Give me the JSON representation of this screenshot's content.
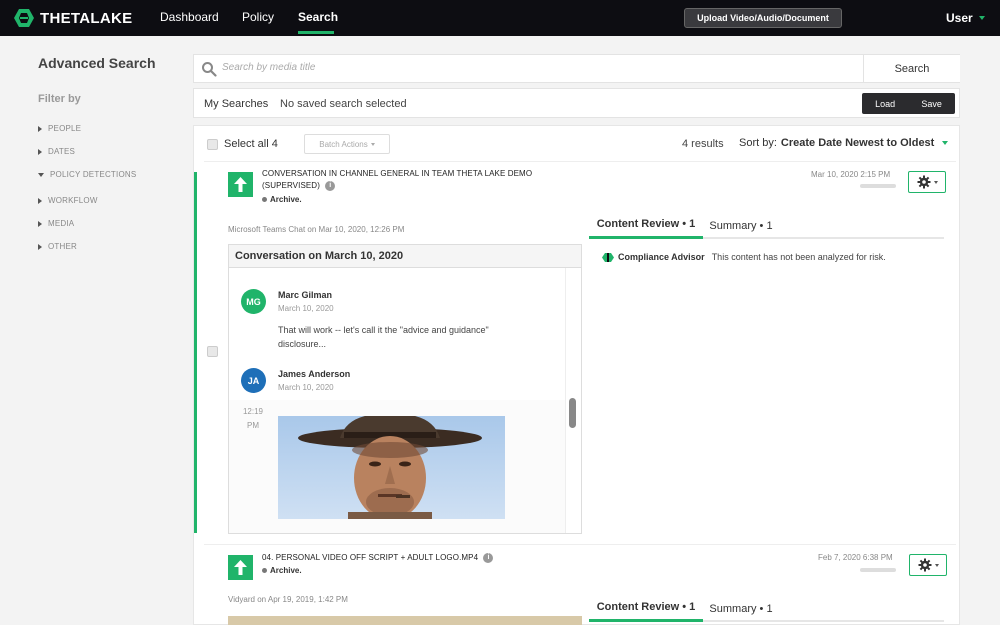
{
  "app": {
    "brand": "THETALAKE",
    "nav": [
      {
        "label": "Dashboard",
        "active": false
      },
      {
        "label": "Policy",
        "active": false
      },
      {
        "label": "Search",
        "active": true
      }
    ],
    "upload_label": "Upload Video/Audio/Document",
    "user_label": "User",
    "accent_color": "#20b46a"
  },
  "sidebar": {
    "title": "Advanced Search",
    "filter_label": "Filter by",
    "filters": [
      {
        "label": "PEOPLE",
        "expanded": false
      },
      {
        "label": "DATES",
        "expanded": false
      },
      {
        "label": "POLICY DETECTIONS",
        "expanded": true
      },
      {
        "label": "WORKFLOW",
        "expanded": false
      },
      {
        "label": "MEDIA",
        "expanded": false
      },
      {
        "label": "OTHER",
        "expanded": false
      }
    ]
  },
  "search": {
    "placeholder": "Search by media title",
    "button_label": "Search",
    "my_searches_label": "My Searches",
    "my_searches_value": "No saved search selected",
    "load_label": "Load",
    "save_label": "Save"
  },
  "results": {
    "select_all_label": "Select all 4",
    "batch_actions_label": "Batch Actions",
    "count_label": "4 results",
    "sort_label": "Sort by:",
    "sort_value": "Create Date Newest to Oldest",
    "items": [
      {
        "title_line1": "CONVERSATION IN CHANNEL GENERAL IN TEAM THETA LAKE DEMO",
        "title_line2": "(SUPERVISED)",
        "status": "Archive.",
        "date": "Mar 10, 2020 2:15 PM",
        "source": "Microsoft Teams Chat on Mar 10, 2020, 12:26 PM",
        "conversation": {
          "title": "Conversation on March 10, 2020",
          "messages": [
            {
              "initials": "MG",
              "name": "Marc Gilman",
              "date": "March 10, 2020",
              "text": "That will work -- let's call it the \"advice and guidance\" disclosure...",
              "avatar_color": "#20b46a"
            },
            {
              "initials": "JA",
              "name": "James Anderson",
              "date": "March 10, 2020",
              "avatar_color": "#1e6fb8"
            }
          ],
          "time_line1": "12:19",
          "time_line2": "PM"
        },
        "tabs": [
          {
            "label": "Content Review • 1",
            "active": true
          },
          {
            "label": "Summary • 1",
            "active": false
          }
        ],
        "compliance_label": "Compliance Advisor",
        "compliance_text": "This content has not been analyzed for risk."
      },
      {
        "title_line1": "04. PERSONAL VIDEO OFF SCRIPT + ADULT LOGO.MP4",
        "status": "Archive.",
        "date": "Feb 7, 2020 6:38 PM",
        "source": "Vidyard on Apr 19, 2019, 1:42 PM",
        "tabs": [
          {
            "label": "Content Review • 1",
            "active": true
          },
          {
            "label": "Summary • 1",
            "active": false
          }
        ]
      }
    ]
  }
}
